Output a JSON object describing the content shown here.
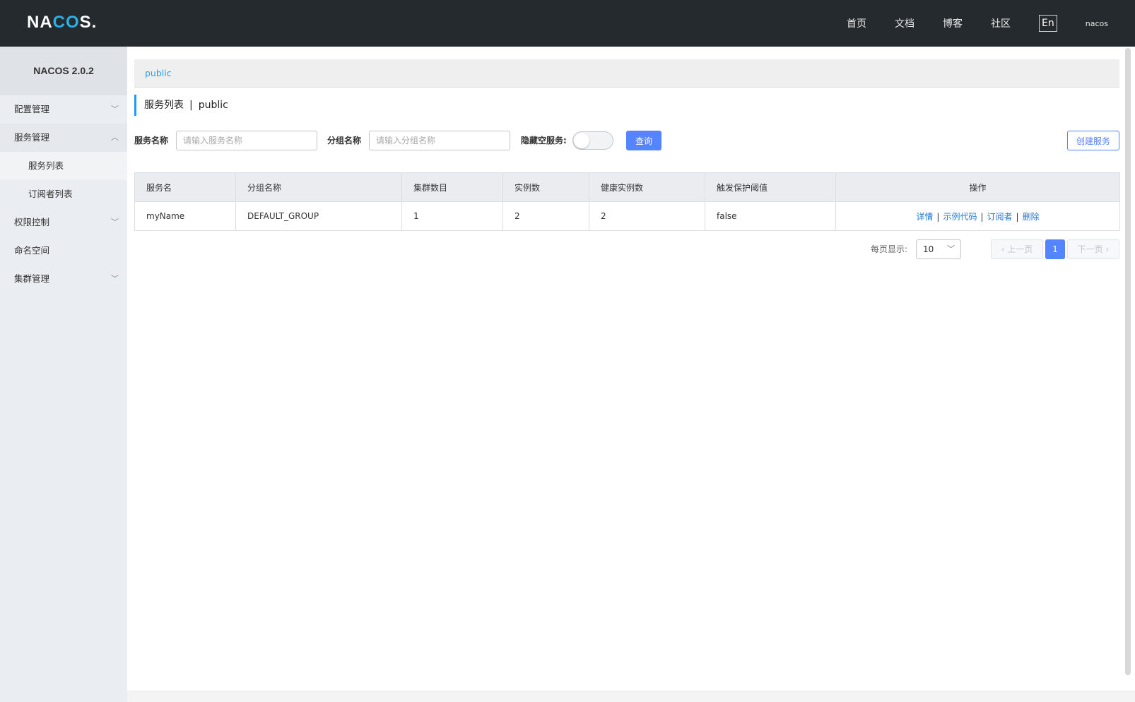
{
  "header": {
    "logo_text_1": "NA",
    "logo_text_accent": "CO",
    "logo_text_2": "S.",
    "nav": [
      "首页",
      "文档",
      "博客",
      "社区"
    ],
    "lang": "En",
    "user": "nacos"
  },
  "sidebar": {
    "title": "NACOS 2.0.2",
    "items": [
      {
        "label": "配置管理",
        "chevron": "chevron-down-icon"
      },
      {
        "label": "服务管理",
        "chevron": "chevron-up-icon"
      },
      {
        "label": "服务列表"
      },
      {
        "label": "订阅者列表"
      },
      {
        "label": "权限控制",
        "chevron": "chevron-down-icon"
      },
      {
        "label": "命名空间"
      },
      {
        "label": "集群管理",
        "chevron": "chevron-down-icon"
      }
    ]
  },
  "namespace": {
    "current": "public"
  },
  "page": {
    "title": "服务列表",
    "namespace": "public"
  },
  "filters": {
    "service_label": "服务名称",
    "service_placeholder": "请输入服务名称",
    "group_label": "分组名称",
    "group_placeholder": "请输入分组名称",
    "hide_empty_label": "隐藏空服务:",
    "query_button": "查询",
    "create_button": "创建服务"
  },
  "table": {
    "columns": [
      "服务名",
      "分组名称",
      "集群数目",
      "实例数",
      "健康实例数",
      "触发保护阈值",
      "操作"
    ],
    "rows": [
      {
        "name": "myName",
        "group": "DEFAULT_GROUP",
        "clusters": "1",
        "instances": "2",
        "healthy": "2",
        "threshold": "false"
      }
    ],
    "ops": [
      "详情",
      "示例代码",
      "订阅者",
      "删除"
    ]
  },
  "pagination": {
    "per_page_label": "每页显示:",
    "per_page": "10",
    "prev": "上一页",
    "next": "下一页",
    "current": "1"
  }
}
